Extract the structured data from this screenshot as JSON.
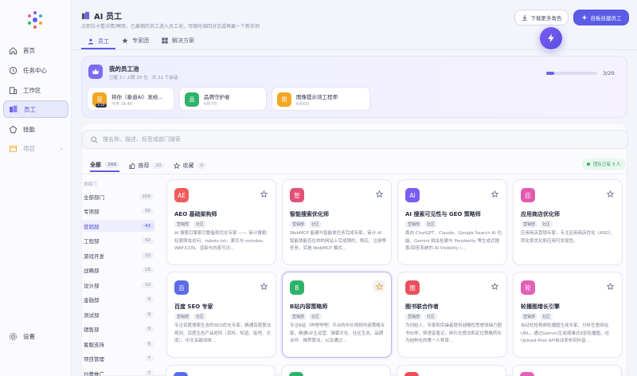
{
  "sidebar": {
    "items": [
      {
        "label": "首页",
        "icon": "home-icon"
      },
      {
        "label": "任务中心",
        "icon": "task-icon"
      },
      {
        "label": "工作区",
        "icon": "workspace-icon"
      },
      {
        "label": "员工",
        "icon": "employee-icon"
      },
      {
        "label": "技能",
        "icon": "skill-icon"
      },
      {
        "label": "项目",
        "icon": "project-icon"
      }
    ],
    "settings_label": "设置"
  },
  "header": {
    "title": "AI 员工",
    "subtitle": "点职位卡看详情/聘用，已雇佣的员工进入员工池，可随时调回对话或再雇一个新实例",
    "btn_download": "下载更多角色",
    "btn_create": "自板自建员工"
  },
  "tabs": [
    {
      "label": "员工",
      "active": true
    },
    {
      "label": "专家团",
      "active": false
    },
    {
      "label": "解决方案",
      "active": false
    }
  ],
  "pool": {
    "title": "我的员工池",
    "subtitle": "已雇 3 / 上限 20 位 · 共 21 个会话",
    "progress_text": "3/20",
    "progress": 0.15,
    "cards": [
      {
        "avatar": "营",
        "name": "将你（泰迪AI）发给…",
        "time": "今天 16:40",
        "badge": "×10",
        "color": "#f2a623"
      },
      {
        "avatar": "品",
        "name": "品牌守护者",
        "time": "6月7日",
        "badge": "",
        "color": "#2fb36a"
      },
      {
        "avatar": "图",
        "name": "图像提示词工程师",
        "time": "6月6日",
        "badge": "",
        "color": "#f2a623"
      }
    ]
  },
  "search": {
    "placeholder": "搜名称、描述、标签或部门搜索"
  },
  "filters": [
    {
      "label": "全部",
      "count": "266",
      "active": true
    },
    {
      "label": "推荐",
      "count": "20",
      "active": false
    },
    {
      "label": "收藏",
      "count": "0",
      "active": false
    }
  ],
  "team_badge": "团队已有 3 人",
  "departments": {
    "label": "按部门",
    "items": [
      {
        "name": "全部部门",
        "count": "266"
      },
      {
        "name": "专项部",
        "count": "56"
      },
      {
        "name": "营销部",
        "count": "43"
      },
      {
        "name": "工程部",
        "count": "42"
      },
      {
        "name": "游戏开发",
        "count": "20"
      },
      {
        "name": "战略部",
        "count": "16"
      },
      {
        "name": "设计部",
        "count": "10"
      },
      {
        "name": "金融部",
        "count": "9"
      },
      {
        "name": "测试部",
        "count": "9"
      },
      {
        "name": "销售部",
        "count": "9"
      },
      {
        "name": "客服支持",
        "count": "6"
      },
      {
        "name": "项目管理",
        "count": "7"
      },
      {
        "name": "付费推广",
        "count": "7"
      }
    ]
  },
  "cards": [
    {
      "avatar": "AE",
      "color": "#ef5b5b",
      "name": "AEO 基础架构师",
      "tags": [
        "营销部",
        "社区"
      ],
      "desc": "AI 搜索引擎索引整备和优化专家 —— 审计搜索/检索爬虫访问、robots.txt、索引与 noindex、WAF/CDN、渲染与内容可访…"
    },
    {
      "avatar": "智",
      "color": "#e2517a",
      "name": "智能搜索优化师",
      "tags": [
        "营销部",
        "社区"
      ],
      "desc": "WebMCP 能建与智能体任务完成专家。审计 AI 智能体能否在你的网站上完成预约、购买、注册等任务，实施 WebMCP 模式…"
    },
    {
      "avatar": "AI",
      "color": "#7a5cf0",
      "name": "AI 搜索可见性与 GEO 策略师",
      "tags": [
        "营销部",
        "社区"
      ],
      "desc": "面向 ChatGPT、Claude、Google Search AI 功能、Gemini 相关检索与 Perplexity 等生成式搜索/回答系统的 AI Visibility /…"
    },
    {
      "avatar": "应",
      "color": "#e35bb0",
      "name": "应用商店优化师",
      "tags": [
        "营销部",
        "社区"
      ],
      "desc": "应用商店营销专家，专注应用商店优化（ASO）、转化率优化和应用可发现性。"
    },
    {
      "avatar": "百",
      "color": "#5b6ce6",
      "name": "百度 SEO 专家",
      "tags": [
        "营销部",
        "社区"
      ],
      "desc": "专注百度搜索生态的SEO优化专家，精通百度算法规则、百度生态产品矩阵（百科、知道、贴吧、文库）、中文关键词研…"
    },
    {
      "avatar": "B",
      "color": "#2fb36a",
      "name": "B站内容策略师",
      "tags": [
        "营销部",
        "社区"
      ],
      "desc": "专注B站（哔哩哔哩）平台的中长视频内容策略专家，精通UP主运营、弹幕文化、社区生态、品牌合作、推荐算法，以及通过…"
    },
    {
      "avatar": "图",
      "color": "#e9505a",
      "name": "图书联合作者",
      "tags": [
        "营销部",
        "社区"
      ],
      "desc": "为创始人、专家和实操者提供战略性思想领袖力图书伙伴，将语音笔记、碎片化想法和定位策略转化为结构化的第一人称章…"
    },
    {
      "avatar": "轮",
      "color": "#e25fb8",
      "name": "轮播图增长引擎",
      "tags": [
        "营销部",
        "社区"
      ],
      "desc": "自动化短视频轮播图生成专家，分析任意网站URL，通过Gemini生成病毒式6张轮播图，经Upload-Post API自动发布到抖音…"
    }
  ],
  "stub_colors": [
    "#5b6ce6",
    "#2fb36a",
    "#e9505a",
    "#e25fb8"
  ]
}
